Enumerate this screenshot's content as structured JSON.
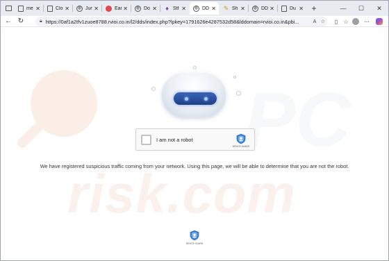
{
  "browser": {
    "tabs": [
      {
        "label": "me",
        "favicon": "doc-icon"
      },
      {
        "label": "Clo",
        "favicon": "doc-icon"
      },
      {
        "label": "Jun",
        "favicon": "globe-icon"
      },
      {
        "label": "Ear",
        "favicon": "red-circle-icon"
      },
      {
        "label": "Do",
        "favicon": "globe-icon"
      },
      {
        "label": "Stf",
        "favicon": "purple-logo-icon"
      },
      {
        "label": "DD",
        "favicon": "globe-icon",
        "active": true
      },
      {
        "label": "Sh",
        "favicon": "gold-logo-icon"
      },
      {
        "label": "DD",
        "favicon": "globe-icon"
      },
      {
        "label": "Du",
        "favicon": "doc-icon"
      }
    ],
    "new_tab_label": "+",
    "address": {
      "url": "https://0af1a2tfv1zuoe8788.rvioi.co.in/l2/dds/index.php?lpkey=1791626e4287532d58&lddomain=rvioi.co.in&pbi..."
    }
  },
  "page": {
    "captcha": {
      "checkbox_label": "I am not a robot",
      "brand": "DEVICE GUARD"
    },
    "message": "We have registered suspicious traffic coming from your network. Using this page, we will be able to determine that you are not the robot.",
    "footer_brand": "DEVICE GUARD",
    "watermark": "risk.com"
  },
  "colors": {
    "accent": "#2d6fd6",
    "shield": "#3a7bd5",
    "tabstrip": "#e8ebf0"
  }
}
